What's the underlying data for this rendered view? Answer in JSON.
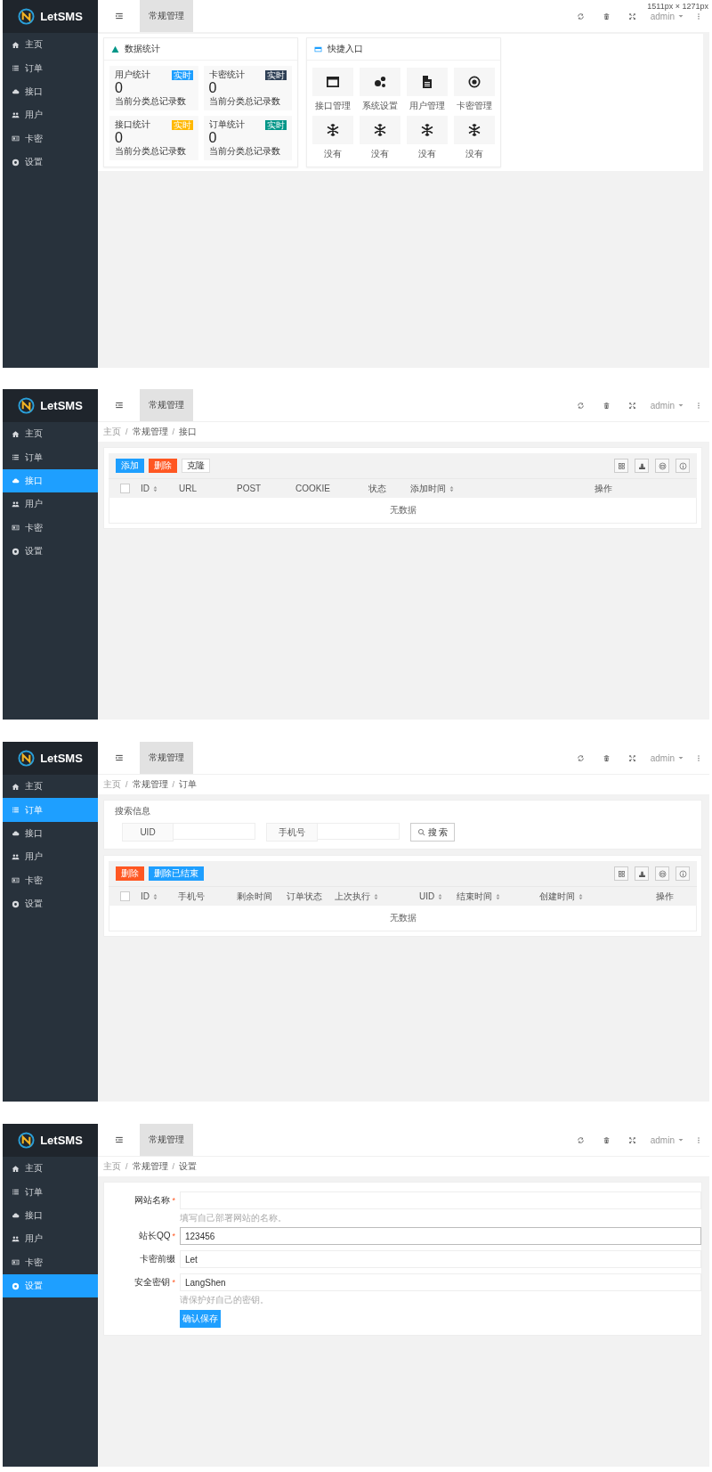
{
  "size_label": "1511px × 1271px",
  "screens": [
    {
      "kind": "dashboard",
      "brand": "LetSMS",
      "sidebar": {
        "items": [
          {
            "label": "主页",
            "selected": false
          },
          {
            "label": "订单",
            "selected": false
          },
          {
            "label": "接口",
            "selected": false
          },
          {
            "label": "用户",
            "selected": false
          },
          {
            "label": "卡密",
            "selected": false
          },
          {
            "label": "设置",
            "selected": false
          }
        ]
      },
      "header": {
        "tabs": [
          {
            "label": "常规管理",
            "selected": true
          }
        ],
        "user": "admin"
      },
      "stats": {
        "title": "数据统计",
        "boxes": [
          {
            "label": "用户统计",
            "badge": "实时",
            "color": "#1e9fff",
            "value": "0",
            "note": "当前分类总记录数"
          },
          {
            "label": "卡密统计",
            "badge": "实时",
            "color": "#2f4056",
            "value": "0",
            "note": "当前分类总记录数"
          },
          {
            "label": "接口统计",
            "badge": "实时",
            "color": "#ffb800",
            "value": "0",
            "note": "当前分类总记录数"
          },
          {
            "label": "订单统计",
            "badge": "实时",
            "color": "#009688",
            "value": "0",
            "note": "当前分类总记录数"
          }
        ]
      },
      "shortcuts": {
        "title": "快捷入口",
        "items": [
          {
            "label": "接口管理"
          },
          {
            "label": "系统设置"
          },
          {
            "label": "用户管理"
          },
          {
            "label": "卡密管理"
          },
          {
            "label": "没有"
          },
          {
            "label": "没有"
          },
          {
            "label": "没有"
          },
          {
            "label": "没有"
          }
        ]
      }
    },
    {
      "kind": "table",
      "brand": "LetSMS",
      "sidebar": {
        "items": [
          {
            "label": "主页",
            "selected": false
          },
          {
            "label": "订单",
            "selected": false
          },
          {
            "label": "接口",
            "selected": true
          },
          {
            "label": "用户",
            "selected": false
          },
          {
            "label": "卡密",
            "selected": false
          },
          {
            "label": "设置",
            "selected": false
          }
        ]
      },
      "header": {
        "tabs": [
          {
            "label": "常规管理",
            "selected": true
          }
        ],
        "user": "admin"
      },
      "breadcrumb": [
        {
          "label": "主页",
          "sep": "/"
        },
        {
          "label": "常规管理",
          "sep": "/"
        },
        {
          "label": "接口"
        }
      ],
      "table": {
        "buttons": [
          {
            "label": "添加",
            "kind": "primary"
          },
          {
            "label": "删除",
            "kind": "danger"
          },
          {
            "label": "克隆",
            "kind": "default"
          }
        ],
        "all_checked": false,
        "columns": [
          {
            "label": "ID",
            "sortable": true
          },
          {
            "label": "URL",
            "sortable": false
          },
          {
            "label": "POST",
            "sortable": false
          },
          {
            "label": "COOKIE",
            "sortable": false
          },
          {
            "label": "状态",
            "sortable": false
          },
          {
            "label": "添加时间",
            "sortable": true
          },
          {
            "label": "操作",
            "sortable": false
          }
        ],
        "empty": "无数据"
      }
    },
    {
      "kind": "search-table",
      "brand": "LetSMS",
      "sidebar": {
        "items": [
          {
            "label": "主页",
            "selected": false
          },
          {
            "label": "订单",
            "selected": true
          },
          {
            "label": "接口",
            "selected": false
          },
          {
            "label": "用户",
            "selected": false
          },
          {
            "label": "卡密",
            "selected": false
          },
          {
            "label": "设置",
            "selected": false
          }
        ]
      },
      "header": {
        "tabs": [
          {
            "label": "常规管理",
            "selected": true
          }
        ],
        "user": "admin"
      },
      "breadcrumb": [
        {
          "label": "主页",
          "sep": "/"
        },
        {
          "label": "常规管理",
          "sep": "/"
        },
        {
          "label": "订单"
        }
      ],
      "search": {
        "legend": "搜索信息",
        "fields": [
          {
            "label": "UID"
          },
          {
            "label": "手机号"
          }
        ],
        "button": "搜 索"
      },
      "table": {
        "buttons": [
          {
            "label": "删除",
            "kind": "danger"
          },
          {
            "label": "删除已结束",
            "kind": "primary"
          }
        ],
        "all_checked": false,
        "columns": [
          {
            "label": "ID",
            "sortable": true
          },
          {
            "label": "手机号",
            "sortable": false
          },
          {
            "label": "剩余时间",
            "sortable": false
          },
          {
            "label": "订单状态",
            "sortable": false
          },
          {
            "label": "上次执行",
            "sortable": true
          },
          {
            "label": "UID",
            "sortable": true
          },
          {
            "label": "结束时间",
            "sortable": true
          },
          {
            "label": "创建时间",
            "sortable": true
          },
          {
            "label": "操作",
            "sortable": false
          }
        ],
        "empty": "无数据"
      }
    },
    {
      "kind": "form",
      "brand": "LetSMS",
      "sidebar": {
        "items": [
          {
            "label": "主页",
            "selected": false
          },
          {
            "label": "订单",
            "selected": false
          },
          {
            "label": "接口",
            "selected": false
          },
          {
            "label": "用户",
            "selected": false
          },
          {
            "label": "卡密",
            "selected": false
          },
          {
            "label": "设置",
            "selected": true
          }
        ]
      },
      "header": {
        "tabs": [
          {
            "label": "常规管理",
            "selected": true
          }
        ],
        "user": "admin"
      },
      "breadcrumb": [
        {
          "label": "主页",
          "sep": "/"
        },
        {
          "label": "常规管理",
          "sep": "/"
        },
        {
          "label": "设置"
        }
      ],
      "form": {
        "fields": [
          {
            "label": "网站名称",
            "required_mark": "*",
            "focused": false,
            "help": "填写自己部署网站的名称。"
          },
          {
            "label": "站长QQ",
            "required_mark": "*",
            "focused": true,
            "value": "123456"
          },
          {
            "label": "卡密前缀",
            "focused": false,
            "value": "Let"
          },
          {
            "label": "安全密钥",
            "required_mark": "*",
            "focused": false,
            "value": "LangShen",
            "help": "请保护好自己的密钥。"
          }
        ],
        "submit": "确认保存"
      }
    }
  ]
}
